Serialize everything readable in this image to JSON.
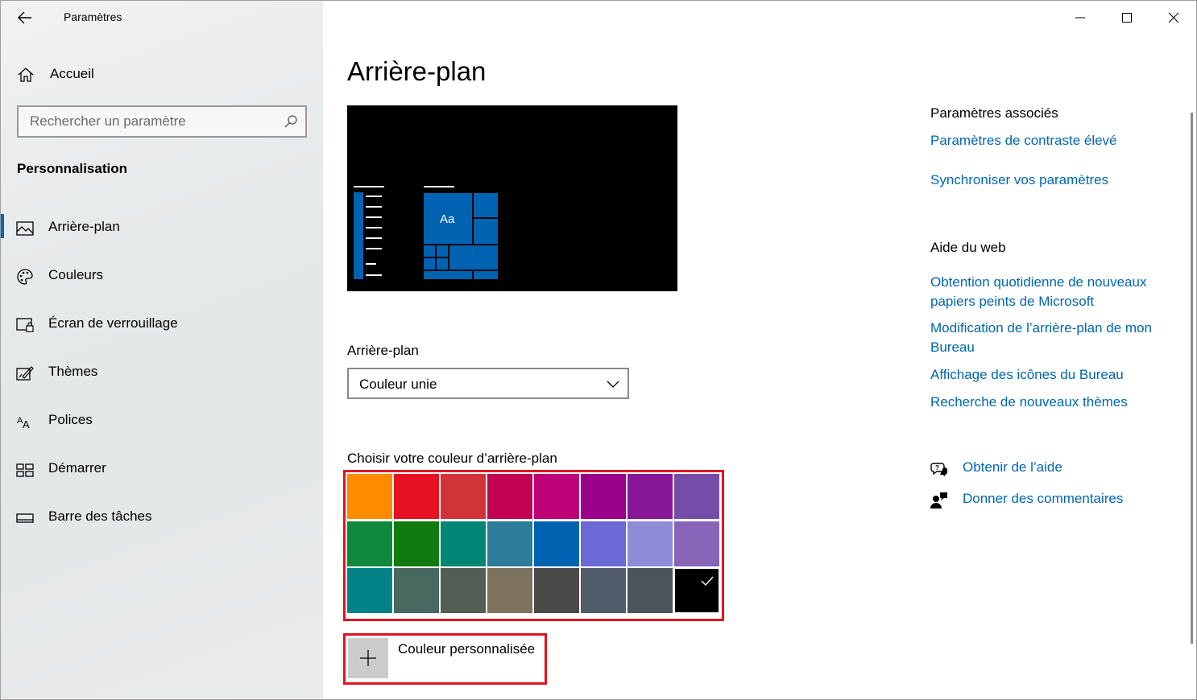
{
  "window": {
    "app_title": "Paramètres",
    "minimize_icon": "minimize-icon",
    "maximize_icon": "maximize-icon",
    "close_icon": "close-icon"
  },
  "sidebar": {
    "home_label": "Accueil",
    "search_placeholder": "Rechercher un paramètre",
    "section_title": "Personnalisation",
    "items": [
      {
        "label": "Arrière-plan",
        "icon": "picture-icon",
        "active": true
      },
      {
        "label": "Couleurs",
        "icon": "palette-icon",
        "active": false
      },
      {
        "label": "Écran de verrouillage",
        "icon": "lock-screen-icon",
        "active": false
      },
      {
        "label": "Thèmes",
        "icon": "themes-icon",
        "active": false
      },
      {
        "label": "Polices",
        "icon": "fonts-icon",
        "active": false
      },
      {
        "label": "Démarrer",
        "icon": "start-icon",
        "active": false
      },
      {
        "label": "Barre des tâches",
        "icon": "taskbar-icon",
        "active": false
      }
    ]
  },
  "main": {
    "title": "Arrière-plan",
    "preview_tile_text": "Aa",
    "background_label": "Arrière-plan",
    "background_value": "Couleur unie",
    "color_label": "Choisir votre couleur d’arrière-plan",
    "colors": [
      [
        "#ff8c00",
        "#e81123",
        "#d13438",
        "#c30052",
        "#bf0077",
        "#9a0089",
        "#881798",
        "#744da9"
      ],
      [
        "#10893e",
        "#107c10",
        "#018574",
        "#2d7d9a",
        "#0063b1",
        "#6b69d6",
        "#8e8cd8",
        "#8764b8"
      ],
      [
        "#038387",
        "#486860",
        "#525e54",
        "#7e735f",
        "#4c4a48",
        "#515c6b",
        "#4a5459",
        "#000000"
      ]
    ],
    "selected_color": "#000000",
    "custom_color_label": "Couleur personnalisée"
  },
  "related": {
    "heading": "Paramètres associés",
    "links": [
      "Paramètres de contraste élevé",
      "Synchroniser vos paramètres"
    ]
  },
  "web_help": {
    "heading": "Aide du web",
    "links": [
      "Obtention quotidienne de nouveaux papiers peints de Microsoft",
      "Modification de l’arrière-plan de mon Bureau",
      "Affichage des icônes du Bureau",
      "Recherche de nouveaux thèmes"
    ]
  },
  "help": {
    "get_help": "Obtenir de l’aide",
    "feedback": "Donner des commentaires"
  },
  "accent_color": "#0067c0",
  "link_color": "#0066b4",
  "highlight_color": "#e0141e"
}
